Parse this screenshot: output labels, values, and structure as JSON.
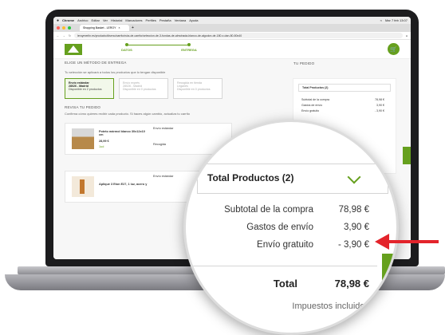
{
  "menubar": {
    "app": "Chrome",
    "items": [
      "Archivo",
      "Editar",
      "Ver",
      "Historial",
      "Marcadores",
      "Perfiles",
      "Pestaña",
      "Ventana",
      "Ayuda"
    ],
    "clock": "Mar 7 feb 13:07"
  },
  "browser": {
    "tab_title": "Shopping Basket - LEROY",
    "url": "leroymerlin.es/producto/diseno/carrito/ruta-de-carrito/seleccion-de-3-fundas-de-almohada-blanco-de-algodon-de-180-x-dan-80-80x40"
  },
  "steps": [
    {
      "label": "DATOS"
    },
    {
      "label": "ENTREGA"
    }
  ],
  "left": {
    "heading": "ELIGE UN MÉTODO DE ENTREGA",
    "subtext": "Tu selección se aplicará a todos los productos que lo tengan disponible",
    "options": [
      {
        "title": "Envío estándar",
        "line2": "28026 - Madrid",
        "line3": "Disponible en 2 productos"
      },
      {
        "title": "Envío exprés",
        "line2": "28026 - Madrid",
        "line3": "Disponible en 0 productos"
      },
      {
        "title": "Recogida en tienda",
        "line2": "Leganés",
        "line3": "Disponible en 0 productos"
      }
    ],
    "review_heading": "REVISA TU PEDIDO",
    "review_sub": "Confirma cómo quieres recibir cada producto. Si haces algún cambio, actualiza tu carrito",
    "products": [
      {
        "name": "Poteto mármol blanco 30x12x10 cm",
        "price": "28,99 €",
        "qty": "1ud",
        "ship_label": "Envío estándar",
        "pickup_label": "Recogida"
      },
      {
        "name": "Aplique 3 Eton E27, 1 luz, acero y",
        "price": "",
        "qty": "",
        "ship_label": "Envío estándar",
        "pickup_label": ""
      }
    ]
  },
  "summary": {
    "heading": "TU PEDIDO",
    "dropdown": "Total Productos (2)",
    "rows": [
      {
        "label": "Subtotal de la compra",
        "value": "78,98 €"
      },
      {
        "label": "Gastos de envío",
        "value": "3,90 €"
      },
      {
        "label": "Envío gratuito",
        "value": "- 3,90 €"
      }
    ]
  },
  "magnifier": {
    "dropdown": "Total Productos (2)",
    "rows": [
      {
        "label": "Subtotal de la compra",
        "value": "78,98 €"
      },
      {
        "label": "Gastos de envío",
        "value": "3,90 €"
      },
      {
        "label": "Envío gratuito",
        "value": "- 3,90 €"
      }
    ],
    "total_label": "Total",
    "total_value": "78,98 €",
    "taxes": "Impuestos incluidos"
  },
  "colors": {
    "brand": "#66a01e",
    "arrow": "#e3242b"
  }
}
